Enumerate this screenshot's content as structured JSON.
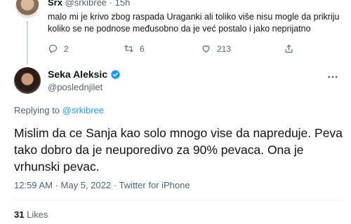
{
  "parent_tweet": {
    "name": "Srx",
    "handle": "@srkibree",
    "time": "15h",
    "text": "malo mi je krivo zbog raspada Uraganki ali toliko više nisu mogle da prikriju koliko se ne podnose međusobno da je već postalo i jako neprijatno",
    "actions": {
      "replies": "2",
      "retweets": "6",
      "likes": "213"
    }
  },
  "main_tweet": {
    "name": "Seka Aleksic",
    "handle": "@poslednjilet",
    "replying_label": "Replying to",
    "replying_to": "@srkibree",
    "text": "Mislim da ce Sanja kao solo mnogo vise da napreduje. Peva tako dobro da je neuporedivo za 90% pevaca. Ona je vrhunski pevac.",
    "time": "12:59 AM",
    "date": "May 5, 2022",
    "client": "Twitter for iPhone",
    "likes_count": "31",
    "likes_label": "Likes"
  },
  "colors": {
    "accent": "#1d9bf0",
    "secondary_text": "#536471",
    "divider": "#eff3f4"
  }
}
